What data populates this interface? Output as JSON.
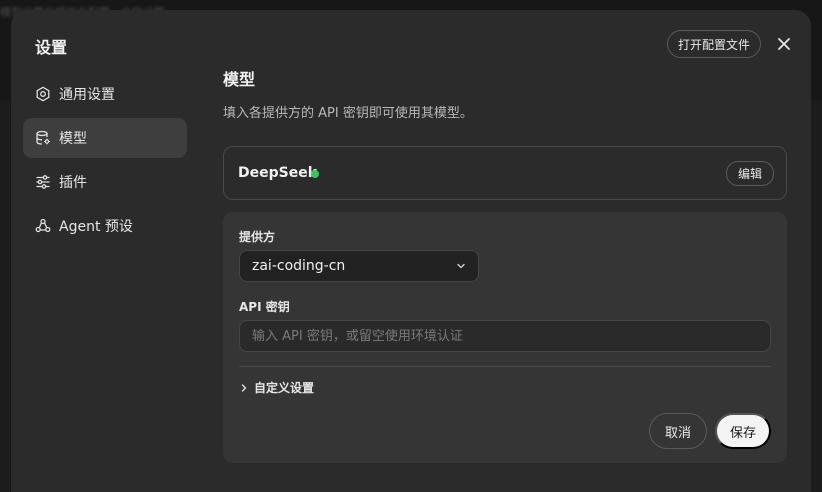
{
  "backdrop": {
    "text": "模型设置与提供方配置 · 全局设置"
  },
  "dialog": {
    "title": "设置",
    "open_config_label": "打开配置文件",
    "close_icon": "close-icon"
  },
  "sidebar": {
    "items": [
      {
        "label": "通用设置",
        "icon": "gear-icon",
        "active": false
      },
      {
        "label": "模型",
        "icon": "database-icon",
        "active": true
      },
      {
        "label": "插件",
        "icon": "sliders-icon",
        "active": false
      },
      {
        "label": "Agent 预设",
        "icon": "agent-icon",
        "active": false
      }
    ]
  },
  "main": {
    "title": "模型",
    "description": "填入各提供方的 API 密钥即可使用其模型。",
    "provider_card": {
      "name": "DeepSeek",
      "status_color": "#34c759",
      "edit_label": "编辑"
    },
    "edit_panel": {
      "provider_label": "提供方",
      "provider_value": "zai-coding-cn",
      "api_key_label": "API 密钥",
      "api_key_value": "",
      "api_key_placeholder": "输入 API 密钥，或留空使用环境认证",
      "custom_settings_label": "自定义设置",
      "cancel_label": "取消",
      "save_label": "保存"
    }
  }
}
